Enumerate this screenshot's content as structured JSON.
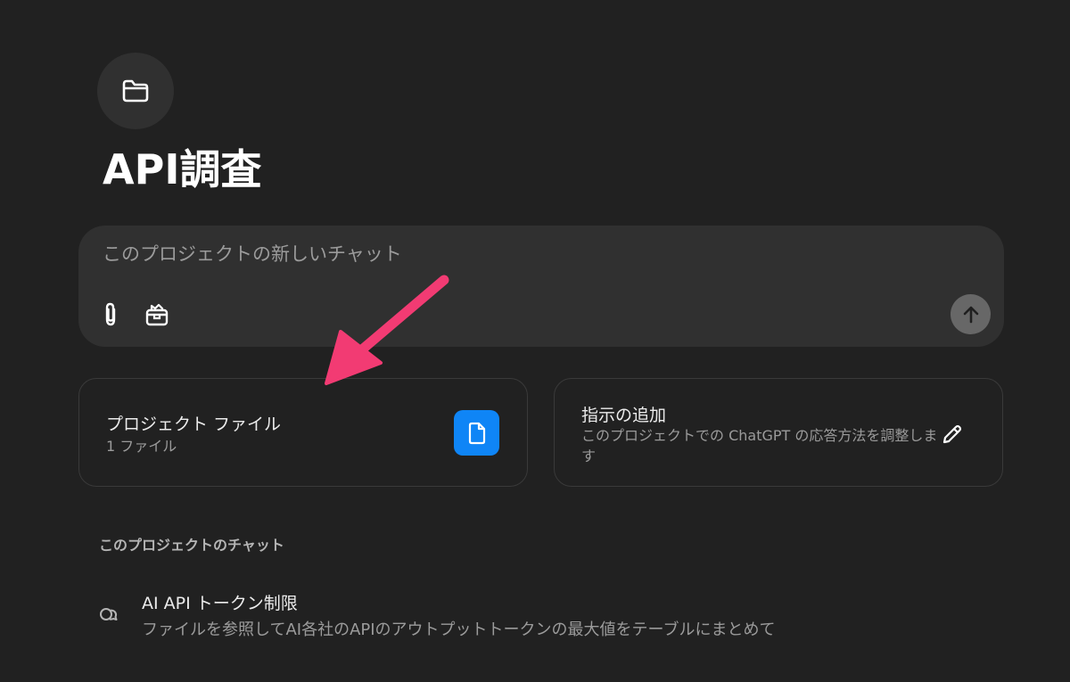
{
  "project": {
    "title": "API調査"
  },
  "composer": {
    "placeholder": "このプロジェクトの新しいチャット",
    "attach_icon": "paperclip-icon",
    "tools_icon": "toolbox-icon",
    "send_icon": "arrow-up-icon"
  },
  "cards": {
    "files": {
      "title": "プロジェクト ファイル",
      "subtitle": "1 ファイル",
      "icon": "document-icon"
    },
    "instructions": {
      "title": "指示の追加",
      "subtitle": "このプロジェクトでの ChatGPT の応答方法を調整します",
      "icon": "pencil-icon"
    }
  },
  "chats": {
    "heading": "このプロジェクトのチャット",
    "items": [
      {
        "title": "AI API トークン制限",
        "snippet": "ファイルを参照してAI各社のAPIのアウトプットトークンの最大値をテーブルにまとめて",
        "icon": "chat-bubbles-icon"
      }
    ]
  },
  "colors": {
    "background": "#212121",
    "surface": "#303030",
    "accent_blue": "#0f85f6",
    "annotation_arrow": "#f23b73"
  }
}
